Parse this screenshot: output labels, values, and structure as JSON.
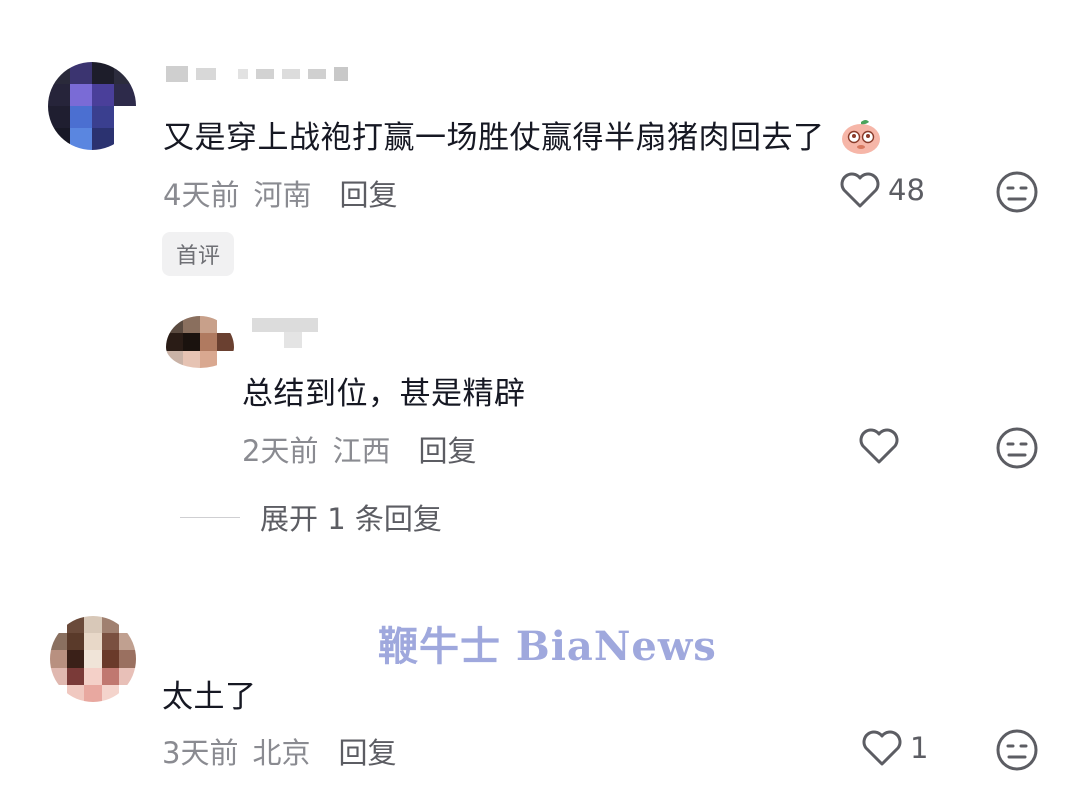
{
  "comments": [
    {
      "text": "又是穿上战袍打赢一场胜仗赢得半扇猪肉回去了",
      "emoji": "peach-face-emoji",
      "time": "4天前",
      "location": "河南",
      "reply_label": "回复",
      "like_count": "48",
      "badge": "首评",
      "replies": [
        {
          "text": "总结到位，甚是精辟",
          "time": "2天前",
          "location": "江西",
          "reply_label": "回复",
          "like_count": ""
        }
      ],
      "expand_label": "展开 1 条回复"
    },
    {
      "text": "太土了",
      "time": "3天前",
      "location": "北京",
      "reply_label": "回复",
      "like_count": "1"
    }
  ],
  "watermark": "鞭牛士 BiaNews",
  "icons": {
    "like": "heart-outline-icon",
    "dislike": "meh-face-icon"
  },
  "colors": {
    "text": "#161823",
    "meta": "#8a8b91",
    "watermark": "#8f9ad8"
  }
}
